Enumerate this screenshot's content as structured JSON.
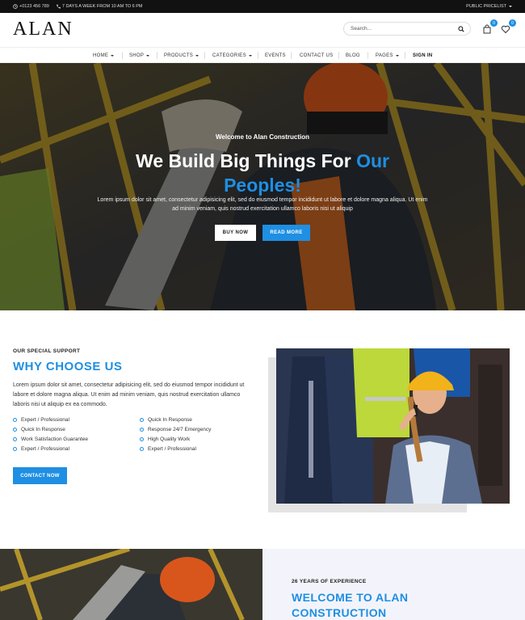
{
  "topbar": {
    "phone": "+0123 456 789",
    "hours": "7 DAYS A WEEK FROM 10 AM TO 6 PM",
    "pricelist": "PUBLIC PRICELIST"
  },
  "header": {
    "logo": "ALAN",
    "search_placeholder": "Search...",
    "cart_count": "0",
    "wishlist_count": "0"
  },
  "nav": {
    "items": [
      "HOME",
      "SHOP",
      "PRODUCTS",
      "CATEGORIES",
      "EVENTS",
      "CONTACT US",
      "BLOG",
      "PAGES",
      "SIGN IN"
    ]
  },
  "hero": {
    "subtitle": "Welcome to Alan Construction",
    "title_line1": "We Build Big Things For",
    "title_highlight1": "Our",
    "title_highlight2": "Peoples!",
    "description": "Lorem ipsum dolor sit amet, consectetur adipisicing elit, sed do eiusmod tempor incididunt ut labore et dolore magna aliqua. Ut enim ad minim veniam, quis nostrud exercitation ullamco laboris nisi ut aliquip",
    "buy_now": "BUY NOW",
    "read_more": "READ MORE"
  },
  "why": {
    "support": "OUR SPECIAL SUPPORT",
    "title": "WHY CHOOSE US",
    "description": "Lorem ipsum dolor sit amet, consectetur adipisicing elit, sed do eiusmod tempor incididunt ut labore et dolore magna aliqua. Ut enim ad minim veniam, quis nostrud exercitation ullamco laboris nisi ut aliquip ex ea commodo.",
    "features_left": [
      "Expert / Professional",
      "Quick In Response",
      "Work Satisfaction Guarantee",
      "Expert / Professional"
    ],
    "features_right": [
      "Quick In Response",
      "Response 24/7 Emergency",
      "High Quality Work",
      "Expert / Professional"
    ],
    "contact_button": "CONTACT NOW"
  },
  "about": {
    "experience": "26 YEARS OF EXPERIENCE",
    "title_line1": "WELCOME TO ALAN",
    "title_line2": "CONSTRUCTION"
  },
  "colors": {
    "accent": "#1e8fe3",
    "topbar": "#111111"
  }
}
